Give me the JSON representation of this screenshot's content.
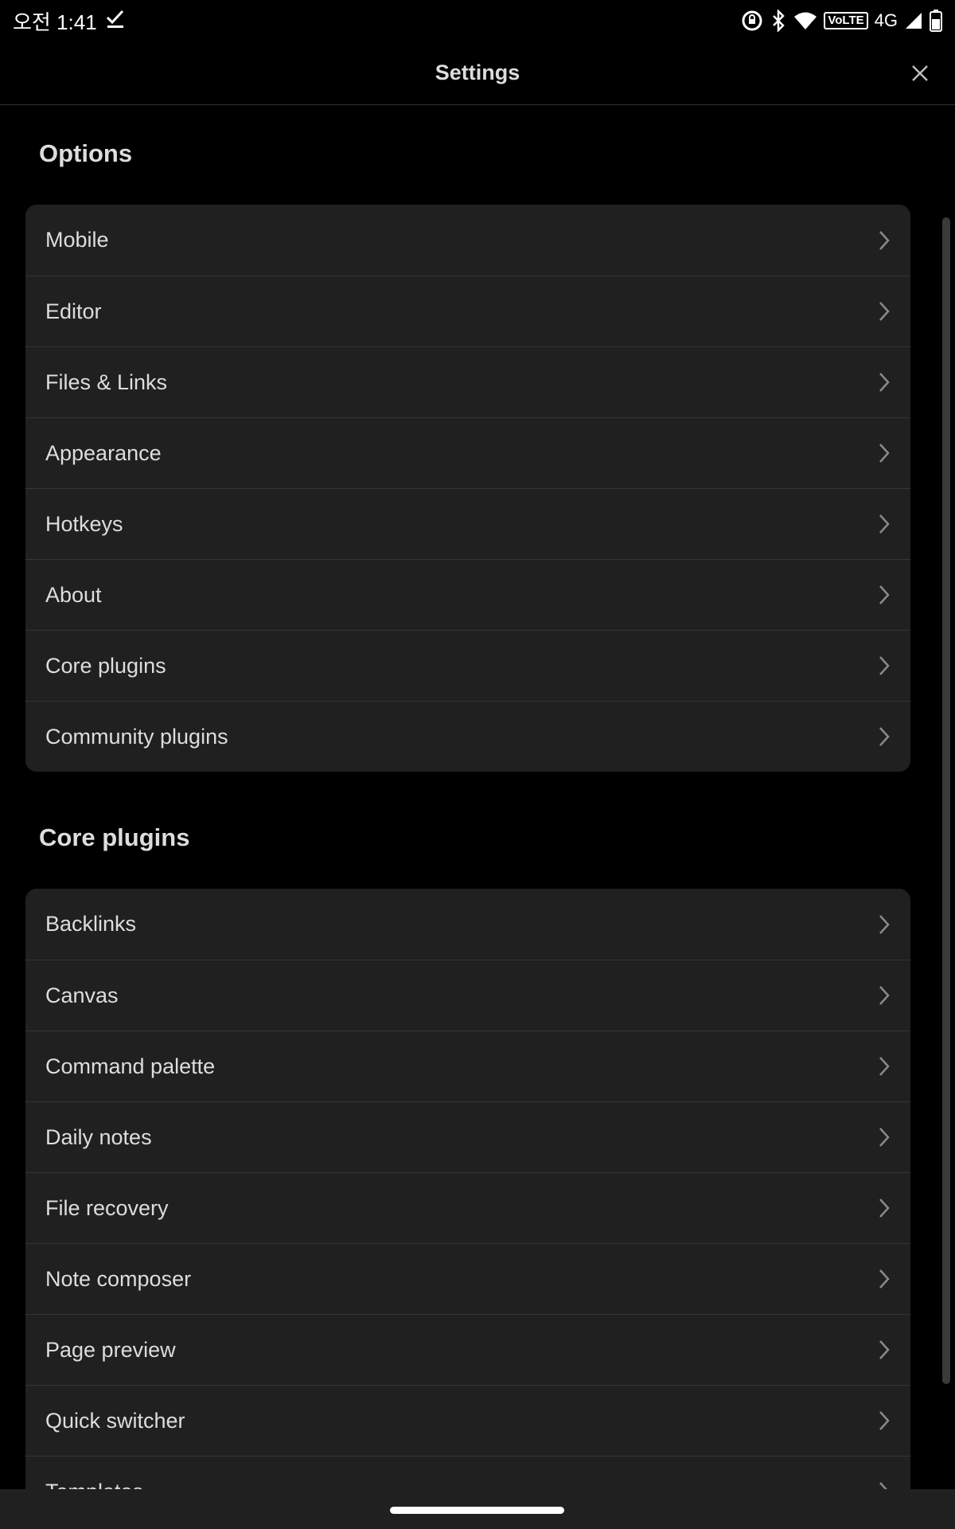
{
  "statusbar": {
    "time": "오전 1:41",
    "network": "4G",
    "volte": "VoLTE"
  },
  "header": {
    "title": "Settings"
  },
  "options": {
    "title": "Options",
    "items": [
      {
        "label": "Mobile"
      },
      {
        "label": "Editor"
      },
      {
        "label": "Files & Links"
      },
      {
        "label": "Appearance"
      },
      {
        "label": "Hotkeys"
      },
      {
        "label": "About"
      },
      {
        "label": "Core plugins"
      },
      {
        "label": "Community plugins"
      }
    ]
  },
  "core_plugins": {
    "title": "Core plugins",
    "items": [
      {
        "label": "Backlinks"
      },
      {
        "label": "Canvas"
      },
      {
        "label": "Command palette"
      },
      {
        "label": "Daily notes"
      },
      {
        "label": "File recovery"
      },
      {
        "label": "Note composer"
      },
      {
        "label": "Page preview"
      },
      {
        "label": "Quick switcher"
      },
      {
        "label": "Templates"
      }
    ]
  },
  "colors": {
    "background": "#000000",
    "card": "#202020",
    "text": "#dcddde",
    "divider": "#353535"
  }
}
